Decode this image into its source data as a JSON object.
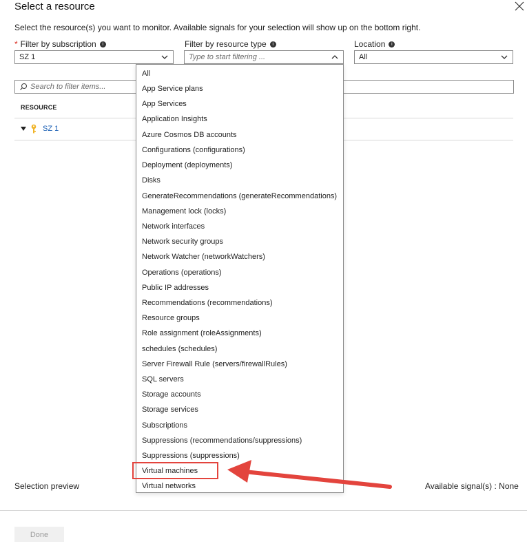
{
  "header": {
    "title": "Select a resource",
    "subtitle": "Select the resource(s) you want to monitor. Available signals for your selection will show up on the bottom right."
  },
  "filters": {
    "subscription": {
      "label": "Filter by subscription",
      "required_mark": "*",
      "value": "SZ 1"
    },
    "resource_type": {
      "label": "Filter by resource type",
      "placeholder": "Type to start filtering ..."
    },
    "location": {
      "label": "Location",
      "value": "All"
    }
  },
  "search": {
    "placeholder": "Search to filter items..."
  },
  "table": {
    "column_header": "RESOURCE",
    "rows": [
      {
        "name": "SZ 1"
      }
    ]
  },
  "dropdown": {
    "options": [
      "All",
      "App Service plans",
      "App Services",
      "Application Insights",
      "Azure Cosmos DB accounts",
      "Configurations (configurations)",
      "Deployment (deployments)",
      "Disks",
      "GenerateRecommendations (generateRecommendations)",
      "Management lock (locks)",
      "Network interfaces",
      "Network security groups",
      "Network Watcher (networkWatchers)",
      "Operations (operations)",
      "Public IP addresses",
      "Recommendations (recommendations)",
      "Resource groups",
      "Role assignment (roleAssignments)",
      "schedules (schedules)",
      "Server Firewall Rule (servers/firewallRules)",
      "SQL servers",
      "Storage accounts",
      "Storage services",
      "Subscriptions",
      "Suppressions (recommendations/suppressions)",
      "Suppressions (suppressions)",
      "Virtual machines",
      "Virtual networks"
    ],
    "highlighted": "Virtual machines"
  },
  "footer": {
    "selection_preview": "Selection preview",
    "available_signals": "Available signal(s) : None",
    "done_label": "Done"
  },
  "colors": {
    "accent_link": "#1a5fb4",
    "required": "#d92b1f",
    "annotation": "#e3443d",
    "key_icon": "#f0b429"
  }
}
